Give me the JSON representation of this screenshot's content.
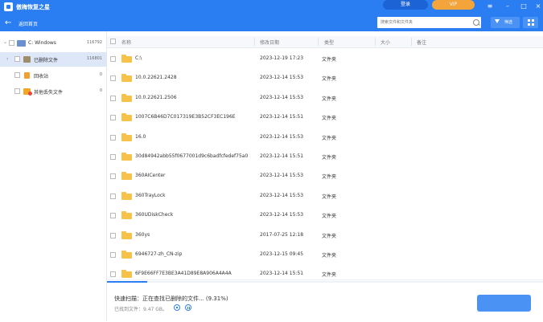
{
  "app": {
    "title": "傲梅恢复之星"
  },
  "header": {
    "login_label": "登录",
    "vip_label": "VIP",
    "menu_icon": "menu-icon",
    "min_icon": "minimize-icon",
    "max_icon": "maximize-icon",
    "close_icon": "close-icon"
  },
  "toolbar": {
    "back_label": "返回首页",
    "search_placeholder": "搜索文件和文件夹",
    "filter_label": "筛选"
  },
  "sidebar": {
    "items": [
      {
        "label": "C: Windows",
        "count": "116792"
      },
      {
        "label": "已删除文件",
        "count": "116801"
      },
      {
        "label": "回收站",
        "count": "0"
      },
      {
        "label": "其他丢失文件",
        "count": "0"
      }
    ]
  },
  "table": {
    "columns": [
      "名称",
      "修改日期",
      "类型",
      "大小",
      "备注"
    ],
    "rows": [
      {
        "name": "C:\\",
        "date": "2023-12-19 17:23",
        "type": "文件夹"
      },
      {
        "name": "10.0.22621.2428",
        "date": "2023-12-14 15:53",
        "type": "文件夹"
      },
      {
        "name": "10.0.22621.2506",
        "date": "2023-12-14 15:53",
        "type": "文件夹"
      },
      {
        "name": "1007C6B46D7C017319E3B52CF3EC196E",
        "date": "2023-12-14 15:51",
        "type": "文件夹"
      },
      {
        "name": "16.0",
        "date": "2023-12-14 15:53",
        "type": "文件夹"
      },
      {
        "name": "30d84942abb55f0677001d9c6badfcfedef75a0",
        "date": "2023-12-14 15:51",
        "type": "文件夹"
      },
      {
        "name": "360AICenter",
        "date": "2023-12-14 15:53",
        "type": "文件夹"
      },
      {
        "name": "360TrayLock",
        "date": "2023-12-14 15:53",
        "type": "文件夹"
      },
      {
        "name": "360UDiskCheck",
        "date": "2023-12-14 15:53",
        "type": "文件夹"
      },
      {
        "name": "360ys",
        "date": "2017-07-25 12:18",
        "type": "文件夹"
      },
      {
        "name": "6946727-zh_CN-zip",
        "date": "2023-12-15 09:45",
        "type": "文件夹"
      },
      {
        "name": "6F9E66FF7E3BE3A41D89E8A906A4A4A",
        "date": "2023-12-14 15:51",
        "type": "文件夹"
      }
    ]
  },
  "scan": {
    "status": "快速扫描：正在查找已删除的文件... (9.31%)",
    "found": "已找到文件：9.47 GB。",
    "progress_fraction": 0.0931
  },
  "colors": {
    "accent": "#2b7ef2",
    "vip": "#f3a43a",
    "folder": "#f7c24a"
  }
}
